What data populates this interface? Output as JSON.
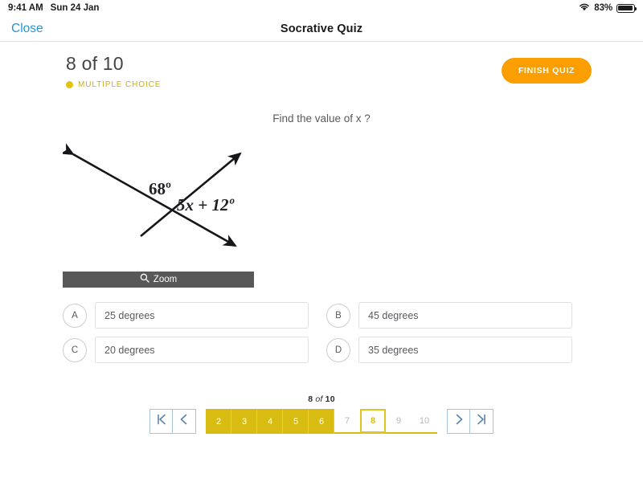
{
  "status_bar": {
    "time": "9:41 AM",
    "date": "Sun 24 Jan",
    "battery_percent": "83%",
    "wifi_icon": "wifi-icon",
    "battery_icon": "battery-icon"
  },
  "nav_bar": {
    "close_label": "Close",
    "title": "Socrative Quiz"
  },
  "question_header": {
    "counter": "8 of 10",
    "type_label": "MULTIPLE CHOICE",
    "type_dot_color": "#e3c311",
    "finish_label": "FINISH QUIZ",
    "finish_color": "#fa9e02"
  },
  "question": {
    "prompt": "Find the value of x ?",
    "figure": {
      "angle_label_1": "68º",
      "angle_label_2": "5x + 12º",
      "description": "two intersecting lines with double-headed arrows"
    },
    "zoom_button_label": "Zoom",
    "zoom_icon": "magnifier-icon"
  },
  "choices": [
    {
      "letter": "A",
      "text": "25 degrees"
    },
    {
      "letter": "B",
      "text": "45 degrees"
    },
    {
      "letter": "C",
      "text": "20 degrees"
    },
    {
      "letter": "D",
      "text": "35 degrees"
    }
  ],
  "pagination": {
    "counter_num": "8",
    "counter_of": " of ",
    "counter_total": "10",
    "first_icon": "first-page-icon",
    "prev_icon": "prev-page-icon",
    "next_icon": "next-page-icon",
    "last_icon": "last-page-icon",
    "answered_color": "#d9bc11",
    "pages": [
      {
        "label": "2",
        "state": "answered"
      },
      {
        "label": "3",
        "state": "answered"
      },
      {
        "label": "4",
        "state": "answered"
      },
      {
        "label": "5",
        "state": "answered"
      },
      {
        "label": "6",
        "state": "answered"
      },
      {
        "label": "7",
        "state": "unanswered"
      },
      {
        "label": "8",
        "state": "current"
      },
      {
        "label": "9",
        "state": "unanswered"
      },
      {
        "label": "10",
        "state": "unanswered"
      }
    ]
  }
}
